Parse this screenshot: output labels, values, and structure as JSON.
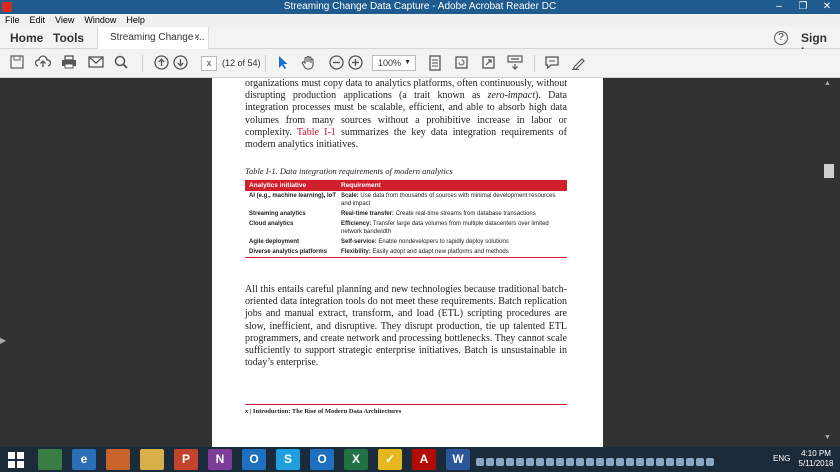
{
  "window": {
    "title": "Streaming Change Data Capture - Adobe Acrobat Reader DC",
    "min": "–",
    "max": "❐",
    "close": "✕"
  },
  "menu": [
    "File",
    "Edit",
    "View",
    "Window",
    "Help"
  ],
  "tabs": {
    "home": "Home",
    "tools": "Tools",
    "document": "Streaming Change ...",
    "close": "×",
    "help": "?",
    "signin": "Sign In"
  },
  "toolbar": {
    "icons": [
      "save-icon",
      "upload-icon",
      "print-icon",
      "email-icon",
      "search-icon",
      "page-up-icon",
      "page-down-icon",
      "select-cursor-icon",
      "hand-icon",
      "zoom-out-icon",
      "zoom-in-icon",
      "fit-page-icon",
      "rotate-icon",
      "fullscreen-icon",
      "read-mode-icon",
      "comment-icon",
      "sign-icon"
    ],
    "page_value": "x",
    "page_count": "(12 of 54)",
    "zoom": "100%"
  },
  "document": {
    "para1_a": "organizations must copy data to analytics platforms, often continuously, without disrupting production applications (a trait known as ",
    "para1_em": "zero-impact",
    "para1_b": "). Data integration processes must be scalable, efficient, and able to absorb high data volumes from many sources without a prohibitive increase in labor or complexity. ",
    "para1_link": "Table I-1",
    "para1_c": " summarizes the key data integration requirements of modern analytics initiatives.",
    "caption": "Table I-1. Data integration requirements of modern analytics",
    "table": {
      "headers": [
        "Analytics initiative",
        "Requirement"
      ],
      "rows": [
        {
          "initiative": "AI (e.g., machine learning), IoT",
          "term": "Scale:",
          "text": "Use data from thousands of sources with minimal development resources and impact"
        },
        {
          "initiative": "Streaming analytics",
          "term": "Real-time transfer:",
          "text": "Create real-time streams from database transactions"
        },
        {
          "initiative": "Cloud analytics",
          "term": "Efficiency:",
          "text": "Transfer large data volumes from multiple datacenters over limited network bandwidth"
        },
        {
          "initiative": "Agile deployment",
          "term": "Self-service:",
          "text": "Enable nondevelopers to rapidly deploy solutions"
        },
        {
          "initiative": "Diverse analytics platforms",
          "term": "Flexibility:",
          "text": "Easily adopt and adapt new platforms and methods"
        }
      ]
    },
    "para2": "All this entails careful planning and new technologies because traditional batch-oriented data integration tools do not meet these requirements. Batch replication jobs and manual extract, transform, and load (ETL) scripting procedures are slow, inefficient, and disruptive. They disrupt production, tie up talented ETL programmers, and create network and processing bottlenecks. They cannot scale sufficiently to support strategic enterprise initiatives. Batch is unsustainable in today’s enterprise.",
    "footer": "x   |   Introduction: The Rise of Modern Data Architectures"
  },
  "taskbar": {
    "apps": [
      {
        "name": "start-button",
        "color": "#1c2b3a",
        "label": ""
      },
      {
        "name": "chrome-icon",
        "color": "#3a7d44",
        "label": ""
      },
      {
        "name": "ie-icon",
        "color": "#2a6fb5",
        "label": "e"
      },
      {
        "name": "firefox-icon",
        "color": "#c8642a",
        "label": ""
      },
      {
        "name": "explorer-icon",
        "color": "#d8b04a",
        "label": ""
      },
      {
        "name": "powerpoint-icon",
        "color": "#c4432b",
        "label": "P"
      },
      {
        "name": "onenote-icon",
        "color": "#7d3c98",
        "label": "N"
      },
      {
        "name": "outlook-icon",
        "color": "#1f6fbf",
        "label": "O"
      },
      {
        "name": "skype-icon",
        "color": "#1ea0e0",
        "label": "S"
      },
      {
        "name": "outlook2-icon",
        "color": "#1f6fbf",
        "label": "O"
      },
      {
        "name": "excel-icon",
        "color": "#207245",
        "label": "X"
      },
      {
        "name": "norton-icon",
        "color": "#e5b81f",
        "label": "✓"
      },
      {
        "name": "acrobat-icon",
        "color": "#b30b00",
        "label": "A"
      },
      {
        "name": "word-icon",
        "color": "#2b579a",
        "label": "W"
      }
    ],
    "lang": "ENG",
    "time": "4:10 PM",
    "date": "5/11/2018"
  }
}
